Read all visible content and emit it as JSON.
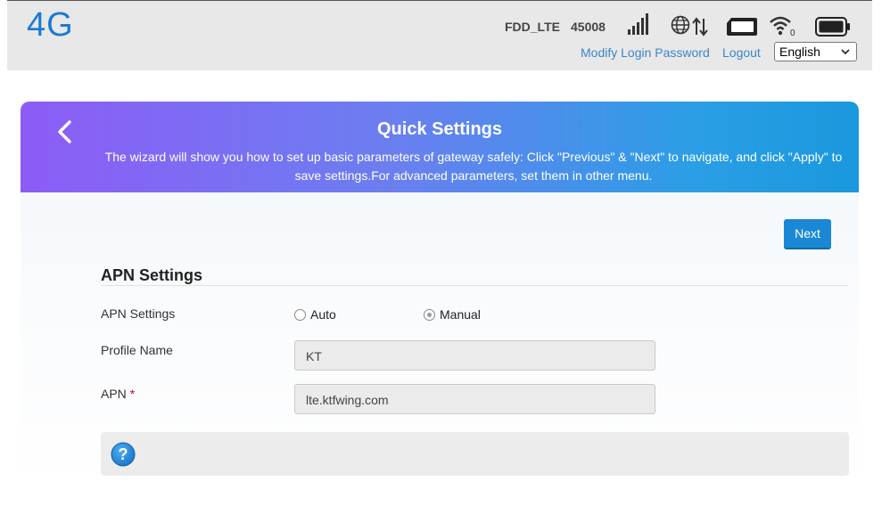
{
  "header": {
    "logo": "4G",
    "network_type": "FDD_LTE",
    "plmn": "45008",
    "signal_bars": 5,
    "modify_password_label": "Modify Login Password",
    "logout_label": "Logout",
    "language_selected": "English"
  },
  "wizard": {
    "title": "Quick Settings",
    "description": "The wizard will show you how to set up basic parameters of gateway safely: Click \"Previous\" & \"Next\" to navigate, and click \"Apply\" to save settings.For advanced parameters, set them in other menu.",
    "next_label": "Next",
    "section_title": "APN Settings",
    "fields": {
      "apn_mode_label": "APN Settings",
      "mode_auto": "Auto",
      "mode_manual": "Manual",
      "mode_selected": "Manual",
      "profile_name_label": "Profile Name",
      "profile_name_value": "KT",
      "apn_label": "APN",
      "apn_required_mark": "*",
      "apn_value": "lte.ktfwing.com"
    }
  },
  "colors": {
    "accent": "#1a88d4",
    "logo": "#1a7bd3",
    "banner_start": "#8d5cf6",
    "banner_end": "#1a98dd"
  },
  "icons": [
    "signal-icon",
    "globe-icon",
    "data-arrows-icon",
    "sim-card-icon",
    "wifi-icon",
    "battery-icon",
    "back-chevron-icon",
    "help-icon"
  ]
}
